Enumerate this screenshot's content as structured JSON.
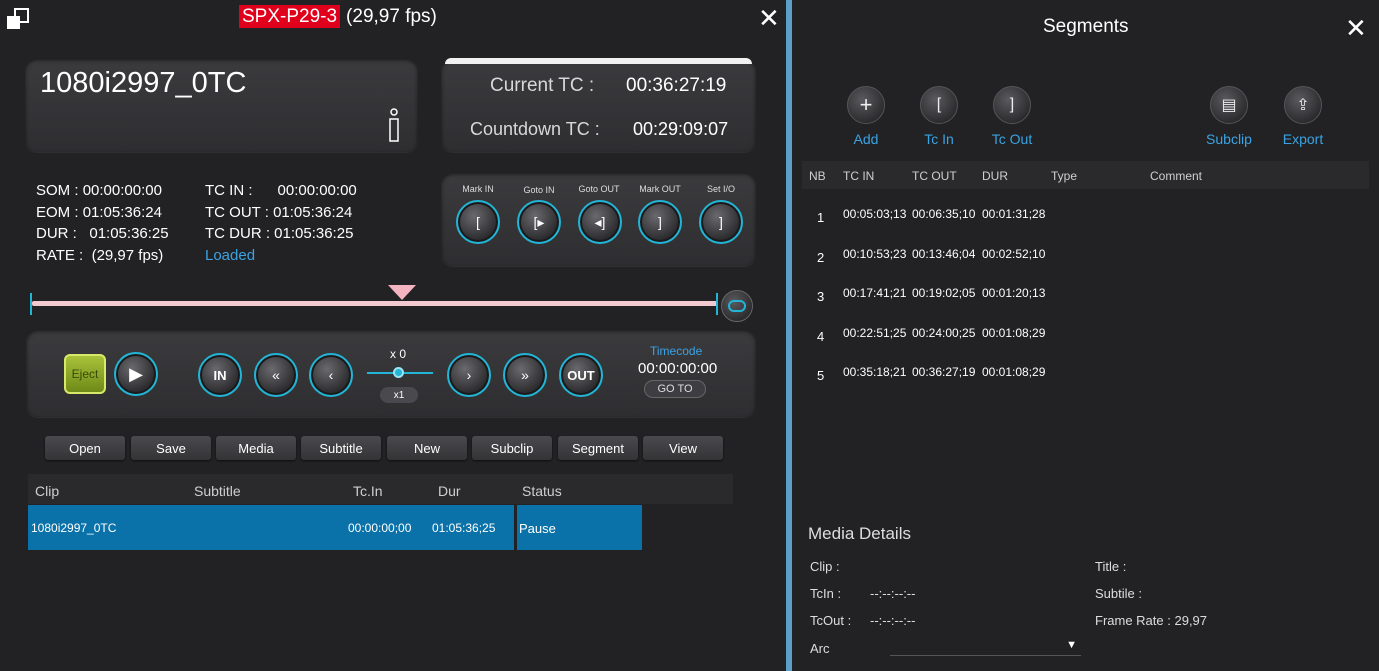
{
  "header": {
    "device": "SPX-P29-3",
    "fps": "(29,97 fps)"
  },
  "clip": {
    "name": "1080i2997_0TC",
    "info_icon": "i"
  },
  "tc": {
    "current_label": "Current TC :",
    "current_value": "00:36:27:19",
    "countdown_label": "Countdown TC :",
    "countdown_value": "00:29:09:07"
  },
  "info": {
    "som_label": "SOM :",
    "som_value": "00:00:00:00",
    "eom_label": "EOM :",
    "eom_value": "01:05:36:24",
    "dur_label": "DUR :",
    "dur_value": "01:05:36:25",
    "rate_label": "RATE :",
    "rate_value": "(29,97 fps)",
    "tcin_label": "TC IN :",
    "tcin_value": "00:00:00:00",
    "tcout_label": "TC OUT :",
    "tcout_value": "01:05:36:24",
    "tcdur_label": "TC DUR :",
    "tcdur_value": "01:05:36:25",
    "status": "Loaded"
  },
  "marks": {
    "mark_in": "Mark IN",
    "goto_in": "Goto IN",
    "goto_out": "Goto OUT",
    "mark_out": "Mark OUT",
    "set_io": "Set I/O"
  },
  "transport": {
    "eject": "Eject",
    "in": "IN",
    "out": "OUT",
    "speed": "x 0",
    "speed_btn": "x1",
    "timecode_label": "Timecode",
    "timecode_value": "00:00:00:00",
    "goto": "GO TO"
  },
  "toolbar": {
    "open": "Open",
    "save": "Save",
    "media": "Media",
    "subtitle": "Subtitle",
    "new": "New",
    "subclip": "Subclip",
    "segment": "Segment",
    "view": "View"
  },
  "playlist": {
    "headers": {
      "clip": "Clip",
      "subtitle": "Subtitle",
      "tcin": "Tc.In",
      "dur": "Dur",
      "status": "Status"
    },
    "rows": [
      {
        "clip": "1080i2997_0TC",
        "subtitle": "",
        "tcin": "00:00:00;00",
        "dur": "01:05:36;25",
        "status": "Pause"
      }
    ]
  },
  "segments": {
    "title": "Segments",
    "actions": {
      "add": "Add",
      "tc_in": "Tc In",
      "tc_out": "Tc Out",
      "subclip": "Subclip",
      "export": "Export"
    },
    "headers": {
      "nb": "NB",
      "tc_in": "TC IN",
      "tc_out": "TC OUT",
      "dur": "DUR",
      "type": "Type",
      "comment": "Comment"
    },
    "rows": [
      {
        "nb": "1",
        "tc_in": "00:05:03;13",
        "tc_out": "00:06:35;10",
        "dur": "00:01:31;28"
      },
      {
        "nb": "2",
        "tc_in": "00:10:53;23",
        "tc_out": "00:13:46;04",
        "dur": "00:02:52;10"
      },
      {
        "nb": "3",
        "tc_in": "00:17:41;21",
        "tc_out": "00:19:02;05",
        "dur": "00:01:20;13"
      },
      {
        "nb": "4",
        "tc_in": "00:22:51;25",
        "tc_out": "00:24:00;25",
        "dur": "00:01:08;29"
      },
      {
        "nb": "5",
        "tc_in": "00:35:18;21",
        "tc_out": "00:36:27;19",
        "dur": "00:01:08;29"
      }
    ]
  },
  "media_details": {
    "title": "Media Details",
    "clip_label": "Clip :",
    "tcin_label": "TcIn :",
    "tcin_value": "--:--:--:--",
    "tcout_label": "TcOut :",
    "tcout_value": "--:--:--:--",
    "arc_label": "Arc",
    "title_label": "Title :",
    "subtitle_label": "Subtile :",
    "framerate_label": "Frame Rate :",
    "framerate_value": "29,97"
  },
  "timeline": {
    "playhead_fraction": 0.54
  },
  "colors": {
    "accent": "#22b5d6",
    "selection": "#0a72a8",
    "status_blue": "#3aa3e3",
    "badge": "#e0001b"
  }
}
